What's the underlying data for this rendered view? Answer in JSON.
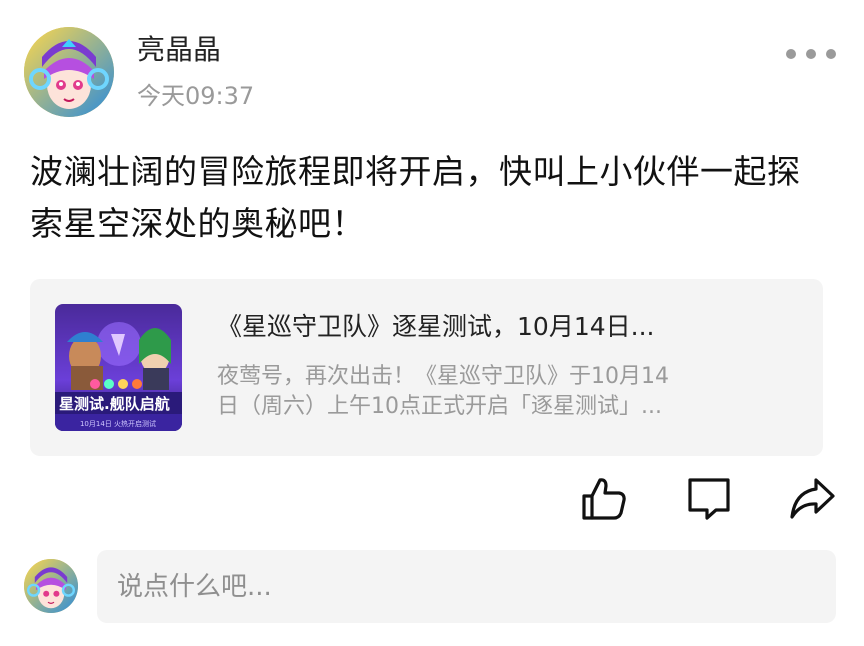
{
  "post": {
    "author": "亮晶晶",
    "time": "今天09:37",
    "text": "波澜壮阔的冒险旅程即将开启，快叫上小伙伴一起探索星空深处的奥秘吧！"
  },
  "article": {
    "title": "《星巡守卫队》逐星测试，10月14日...",
    "summary_lines": [
      "夜莺号，再次出击！《星巡守卫队》于10月14",
      "日（周六）上午10点正式开启「逐星测试」..."
    ],
    "thumbnail_banner": "星测试.舰队启航",
    "thumbnail_subtext": "10月14日 火热开启测试"
  },
  "actions": {
    "like_icon": "thumbs-up-icon",
    "comment_icon": "comment-icon",
    "share_icon": "share-icon",
    "more_icon": "more-dots-icon"
  },
  "comment": {
    "placeholder": "说点什么吧..."
  },
  "colors": {
    "background": "#ffffff",
    "card_background": "#f4f4f4",
    "secondary_text": "#9a9a9a",
    "primary_text": "#111111"
  }
}
